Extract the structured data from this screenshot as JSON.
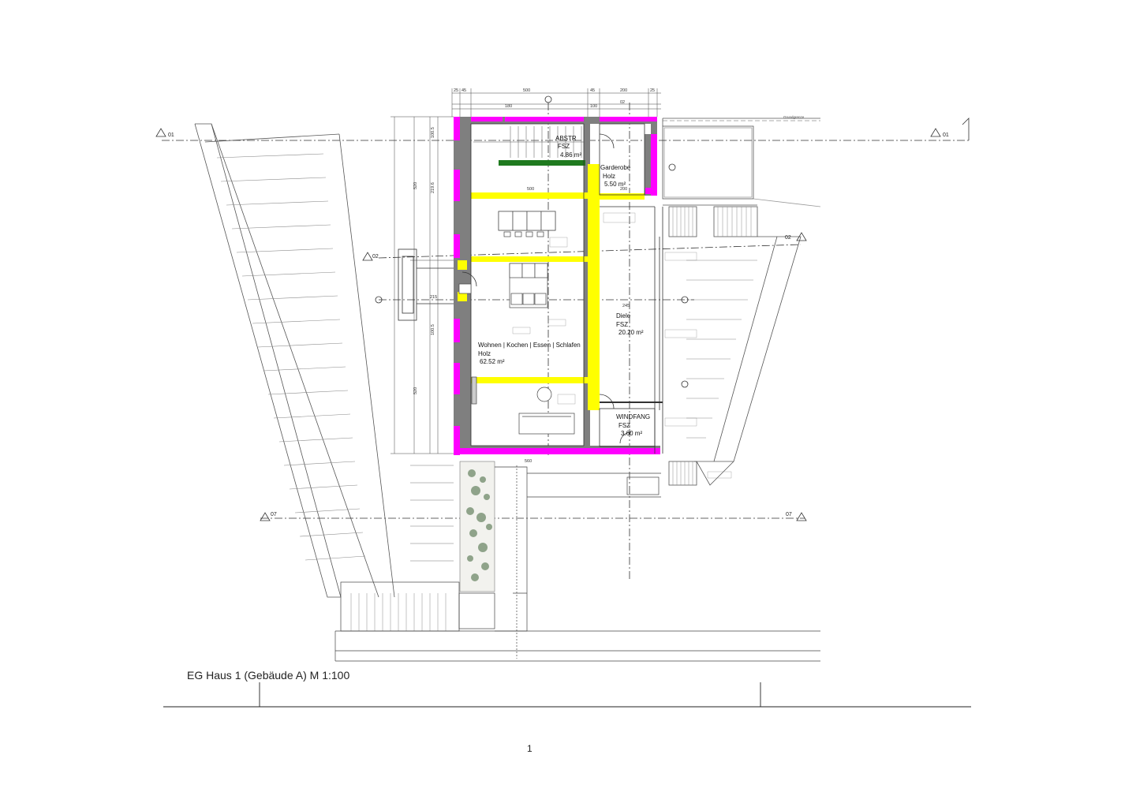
{
  "caption": "EG Haus 1 (Gebäude A) M 1:100",
  "page_number": "1",
  "property_line_label": "Grundgrenze",
  "section_markers": {
    "s01": "01",
    "s02": "02",
    "s07": "07"
  },
  "rooms": {
    "abstellraum": {
      "name": "ABSTR",
      "floor": "FSZ",
      "area": "4.86 m²"
    },
    "garderobe": {
      "name": "Garderobe",
      "floor": "Holz",
      "area": "5.50 m²"
    },
    "wohnen": {
      "name": "Wohnen | Kochen | Essen | Schlafen",
      "floor": "Holz",
      "area": "62.52 m²"
    },
    "diele": {
      "name": "Diele",
      "floor": "FSZ",
      "area": "20.20 m²"
    },
    "windfang": {
      "name": "WINDFANG",
      "floor": "FSZ",
      "area": "3.60 m²"
    }
  },
  "dimensions": {
    "top_row": [
      "25",
      "45",
      "500",
      "45",
      "200",
      "25"
    ],
    "top_row2": [
      "180",
      "500",
      "02"
    ],
    "left_col": [
      "520",
      "219.6",
      "520"
    ],
    "inner": [
      "500",
      "200",
      "245",
      "350",
      "500",
      "215"
    ]
  },
  "colors": {
    "wall_new": "#ff00ff",
    "wall_demo": "#ffff00",
    "wall_existing": "#7f7f7f",
    "green_strip": "#1f7a1f",
    "line": "#333333",
    "planter": "#8fa38a"
  }
}
